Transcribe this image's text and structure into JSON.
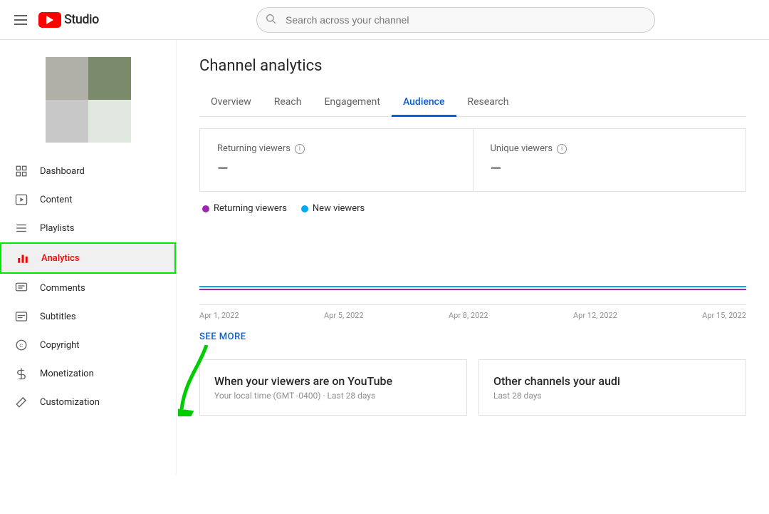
{
  "header": {
    "menu_label": "Menu",
    "logo_text": "Studio",
    "search_placeholder": "Search across your channel"
  },
  "sidebar": {
    "nav_items": [
      {
        "id": "dashboard",
        "label": "Dashboard",
        "icon": "grid"
      },
      {
        "id": "content",
        "label": "Content",
        "icon": "play"
      },
      {
        "id": "playlists",
        "label": "Playlists",
        "icon": "list"
      },
      {
        "id": "analytics",
        "label": "Analytics",
        "icon": "bar-chart",
        "active": true
      },
      {
        "id": "comments",
        "label": "Comments",
        "icon": "comment"
      },
      {
        "id": "subtitles",
        "label": "Subtitles",
        "icon": "subtitles"
      },
      {
        "id": "copyright",
        "label": "Copyright",
        "icon": "copyright"
      },
      {
        "id": "monetization",
        "label": "Monetization",
        "icon": "dollar"
      },
      {
        "id": "customization",
        "label": "Customization",
        "icon": "magic"
      }
    ]
  },
  "main": {
    "page_title": "Channel analytics",
    "tabs": [
      {
        "id": "overview",
        "label": "Overview"
      },
      {
        "id": "reach",
        "label": "Reach"
      },
      {
        "id": "engagement",
        "label": "Engagement"
      },
      {
        "id": "audience",
        "label": "Audience",
        "active": true
      },
      {
        "id": "research",
        "label": "Research"
      }
    ],
    "stats": [
      {
        "label": "Returning viewers",
        "value": "—"
      },
      {
        "label": "Unique viewers",
        "value": "—"
      }
    ],
    "legend": [
      {
        "label": "Returning viewers",
        "color": "purple"
      },
      {
        "label": "New viewers",
        "color": "blue"
      }
    ],
    "xaxis": [
      "Apr 1, 2022",
      "Apr 5, 2022",
      "Apr 8, 2022",
      "Apr 12, 2022",
      "Apr 15, 2022"
    ],
    "see_more": "SEE MORE",
    "bottom_cards": [
      {
        "title": "When your viewers are on YouTube",
        "subtitle": "Your local time (GMT -0400) · Last 28 days"
      },
      {
        "title": "Other channels your audi",
        "subtitle": "Last 28 days"
      }
    ]
  }
}
